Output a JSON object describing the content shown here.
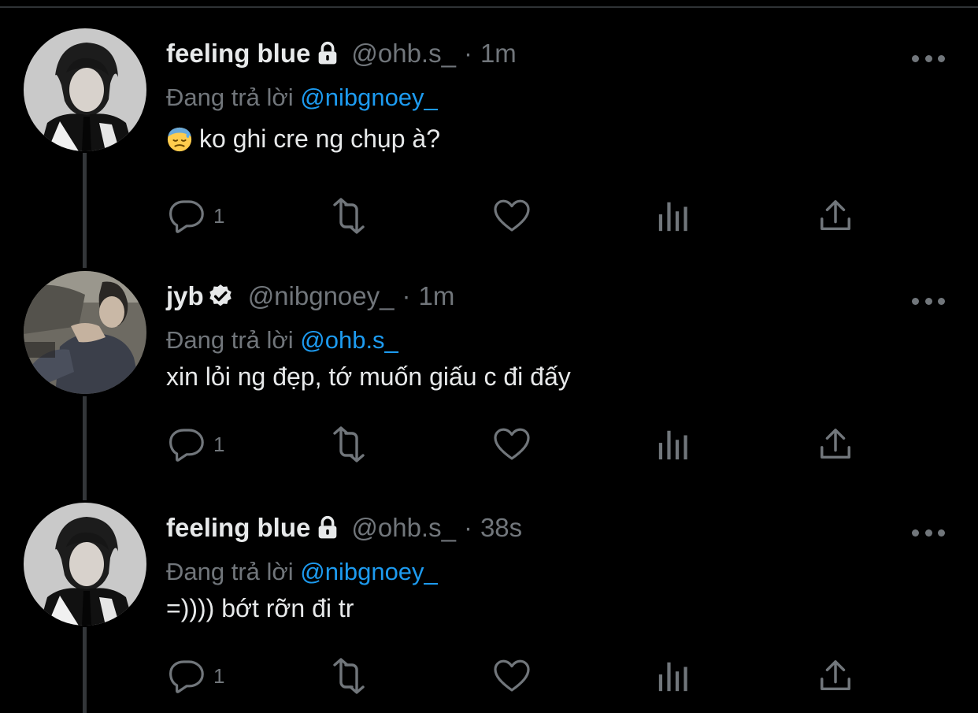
{
  "tweets": [
    {
      "display_name": "feeling blue",
      "badge_icon": "lock-icon",
      "handle": "@ohb.s_",
      "separator": "·",
      "time": "1m",
      "reply_prefix": "Đang trả lời",
      "reply_to": "@nibgnoey_",
      "body_emoji_icon": "downcast-face-with-sweat-emoji",
      "text": "ko ghi cre ng chụp à?",
      "reply_count": "1"
    },
    {
      "display_name": "jyb",
      "badge_icon": "verified-badge-icon",
      "handle": "@nibgnoey_",
      "separator": "·",
      "time": "1m",
      "reply_prefix": "Đang trả lời",
      "reply_to": "@ohb.s_",
      "text": "xin lỏi ng đẹp, tớ muốn giấu c đi đấy",
      "reply_count": "1"
    },
    {
      "display_name": "feeling blue",
      "badge_icon": "lock-icon",
      "handle": "@ohb.s_",
      "separator": "·",
      "time": "38s",
      "reply_prefix": "Đang trả lời",
      "reply_to": "@nibgnoey_",
      "text": "=)))) bớt rỡn đi tr",
      "reply_count": "1"
    }
  ],
  "colors": {
    "background": "#000000",
    "primary_text": "#e7e9ea",
    "secondary_text": "#71767b",
    "mention": "#1d9bf0",
    "thread_line": "#333639"
  },
  "icons": [
    "reply-icon",
    "retweet-icon",
    "like-icon",
    "views-icon",
    "share-icon",
    "more-icon"
  ]
}
